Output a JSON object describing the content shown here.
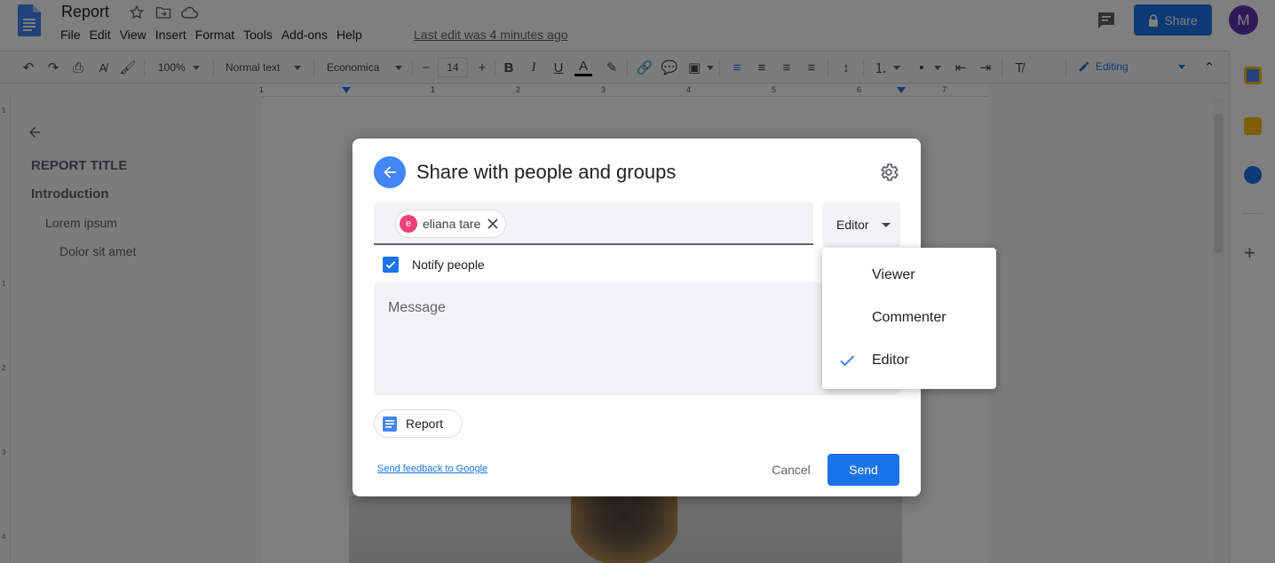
{
  "header": {
    "doc_title": "Report",
    "menu": [
      "File",
      "Edit",
      "View",
      "Insert",
      "Format",
      "Tools",
      "Add-ons",
      "Help"
    ],
    "last_edit": "Last edit was 4 minutes ago",
    "share_label": "Share",
    "avatar_letter": "M"
  },
  "toolbar": {
    "zoom": "100%",
    "style": "Normal text",
    "font": "Economica",
    "font_size": "14",
    "mode": "Editing"
  },
  "ruler": {
    "numbers": [
      "1",
      "1",
      "2",
      "3",
      "4",
      "5",
      "6",
      "7"
    ],
    "vertical_numbers": [
      "1",
      "1",
      "2",
      "3",
      "4"
    ]
  },
  "outline": {
    "items": [
      "REPORT TITLE",
      "Introduction",
      "Lorem ipsum",
      "Dolor sit amet"
    ]
  },
  "dialog": {
    "title": "Share with people and groups",
    "recipient": {
      "name": "eliana tare",
      "initial": "e"
    },
    "role_button": "Editor",
    "notify_label": "Notify people",
    "notify_checked": true,
    "message_placeholder": "Message",
    "doc_chip": "Report",
    "feedback_link": "Send feedback to Google",
    "cancel_label": "Cancel",
    "send_label": "Send"
  },
  "role_menu": {
    "items": [
      {
        "label": "Viewer",
        "selected": false
      },
      {
        "label": "Commenter",
        "selected": false
      },
      {
        "label": "Editor",
        "selected": true
      }
    ]
  },
  "colors": {
    "accent": "#1a73e8",
    "chip_avatar": "#ec407a",
    "user_avatar": "#5e35b1"
  },
  "icons": [
    "docs-logo-icon",
    "star-icon",
    "folder-move-icon",
    "cloud-status-icon",
    "comments-icon",
    "lock-icon",
    "back-arrow-icon",
    "settings-gear-icon",
    "close-icon",
    "checkmark-icon",
    "dropdown-caret-icon",
    "google-docs-file-icon"
  ]
}
